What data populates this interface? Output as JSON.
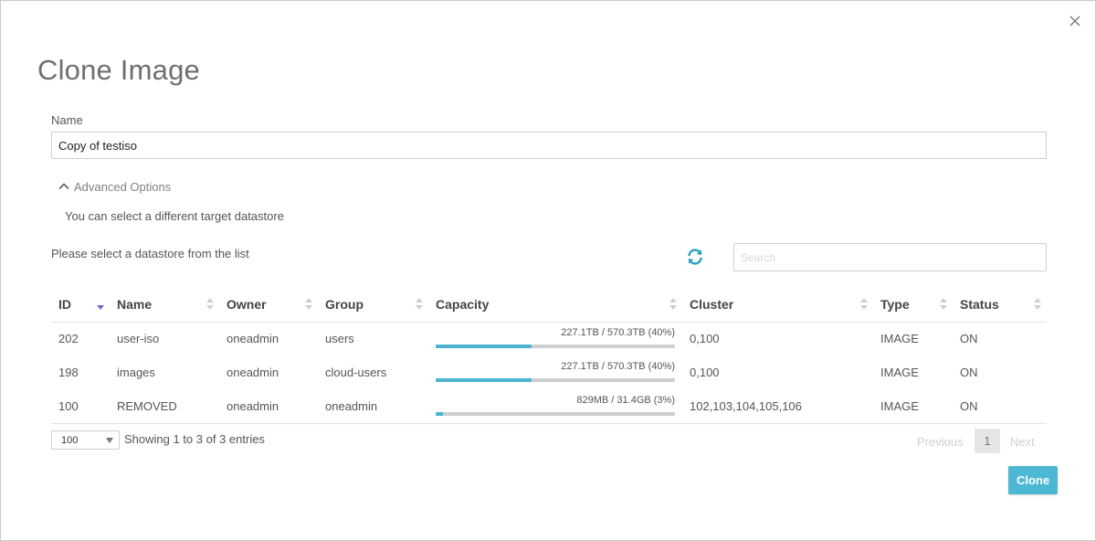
{
  "dialog": {
    "title": "Clone Image",
    "name_label": "Name",
    "name_value": "Copy of testiso",
    "advanced_label": "Advanced Options",
    "advanced_text": "You can select a different target datastore",
    "select_prompt": "Please select a datastore from the list",
    "search_placeholder": "Search",
    "clone_label": "Clone"
  },
  "colors": {
    "accent": "#4cb8d3",
    "progress_fill": "#4db3cf",
    "progress_track": "#cfcfcf",
    "refresh_icon": "#2a9fc0",
    "sort_active": "#6c6cc8"
  },
  "table": {
    "columns": [
      "ID",
      "Name",
      "Owner",
      "Group",
      "Capacity",
      "Cluster",
      "Type",
      "Status"
    ],
    "sorted_column": "ID",
    "rows": [
      {
        "id": "202",
        "name": "user-iso",
        "owner": "oneadmin",
        "group": "users",
        "capacity": "227.1TB / 570.3TB (40%)",
        "capacity_fraction": 0.4,
        "cluster": "0,100",
        "type": "IMAGE",
        "status": "ON"
      },
      {
        "id": "198",
        "name": "images",
        "owner": "oneadmin",
        "group": "cloud-users",
        "capacity": "227.1TB / 570.3TB (40%)",
        "capacity_fraction": 0.4,
        "cluster": "0,100",
        "type": "IMAGE",
        "status": "ON"
      },
      {
        "id": "100",
        "name": "REMOVED",
        "owner": "oneadmin",
        "group": "oneadmin",
        "capacity": "829MB / 31.4GB (3%)",
        "capacity_fraction": 0.03,
        "cluster": "102,103,104,105,106",
        "type": "IMAGE",
        "status": "ON"
      }
    ]
  },
  "footer": {
    "page_length": "100",
    "info": "Showing 1 to 3 of 3 entries",
    "previous": "Previous",
    "current_page": "1",
    "next": "Next"
  }
}
